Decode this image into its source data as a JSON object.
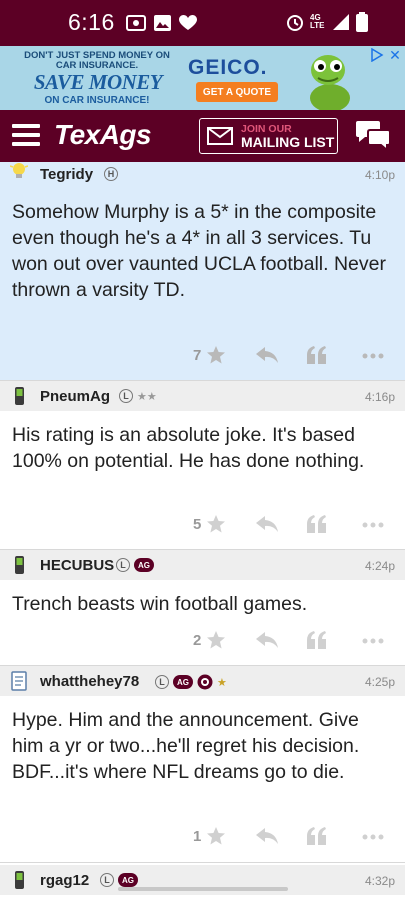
{
  "status_bar": {
    "time": "6:16",
    "network": "4G LTE"
  },
  "ad": {
    "line1": "DON'T JUST SPEND MONEY ON CAR INSURANCE.",
    "headline": "SAVE MONEY",
    "line3": "ON CAR INSURANCE!",
    "brand": "GEICO.",
    "cta": "GET A QUOTE",
    "close": "✕"
  },
  "header": {
    "logo": "TexAgs",
    "mailing_top": "JOIN OUR",
    "mailing_bottom": "MAILING LIST"
  },
  "posts": [
    {
      "username": "Tegridy",
      "user_icon": "lightbulb-icon",
      "badge": "H",
      "time": "4:10p",
      "body": "Somehow Murphy is a 5* in the composite even though he's a 4* in all 3 services. Tu won out over vaunted UCLA football. Never thrown a varsity TD.",
      "stars": "7",
      "highlighted": true
    },
    {
      "username": "PneumAg",
      "user_icon": "phone-icon",
      "badge": "L",
      "rank": "★★",
      "time": "4:16p",
      "body": "His rating is an absolute joke. It's based 100% on potential. He has done nothing.",
      "stars": "5"
    },
    {
      "username": "HECUBUS",
      "user_icon": "phone-icon",
      "badge": "L",
      "badge2": "AG",
      "time": "4:24p",
      "body": "Trench beasts win football games.",
      "stars": "2"
    },
    {
      "username": "whatthehey78",
      "user_icon": "notepad-icon",
      "badge": "L",
      "badge2": "AG",
      "rank": "★",
      "time": "4:25p",
      "body": "Hype. Him and the announcement. Give him a yr or two...he'll regret his decision. BDF...it's where NFL dreams go to die.",
      "stars": "1"
    },
    {
      "username": "rgag12",
      "user_icon": "phone-icon",
      "badge": "L",
      "badge2": "AG",
      "time": "4:32p"
    }
  ],
  "colors": {
    "maroon": "#5c0025",
    "highlight": "#dcecfb",
    "header_row": "#eeeeee"
  }
}
